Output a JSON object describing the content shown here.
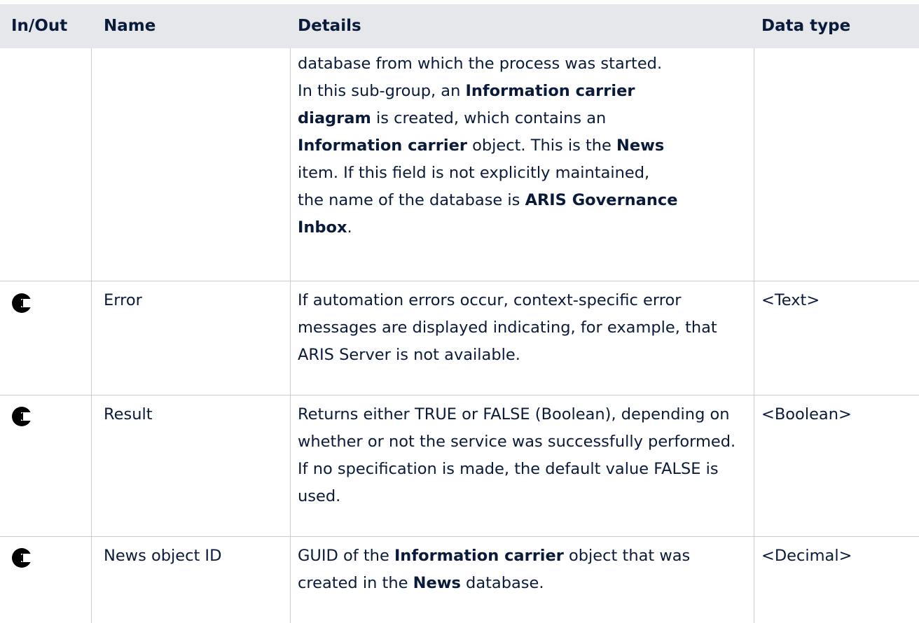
{
  "headers": {
    "inout": "In/Out",
    "name": "Name",
    "details": "Details",
    "datatype": "Data type"
  },
  "continued": {
    "line1": "database from which the process was started.",
    "line2a": "In this sub-group, an ",
    "line2b": "Information carrier",
    "line3a": "diagram",
    "line3b": " is created, which contains an",
    "line4a": "Information carrier",
    "line4b": " object. This is the ",
    "line4c": "News",
    "line5": "item. If this field is not explicitly maintained,",
    "line6a": "the name of the database is ",
    "line6b": "ARIS Governance",
    "line7a": "Inbox",
    "line7b": "."
  },
  "rows": [
    {
      "name": "Error",
      "details": "If automation errors occur, context-specific error messages are displayed indicating, for example, that ARIS Server is not available.",
      "datatype": "<Text>"
    },
    {
      "name": "Result",
      "details": "Returns either TRUE or FALSE (Boolean), depending on whether or not the service was successfully performed. If no specification is made, the default value FALSE is used.",
      "datatype": "<Boolean>"
    },
    {
      "name": "News object ID",
      "details_a": "GUID of the ",
      "details_b": "Information carrier",
      "details_c": " object that was created in the ",
      "details_d": "News",
      "details_e": " database.",
      "datatype": "<Decimal>"
    }
  ],
  "icons": {
    "output": "output-arrow-icon"
  }
}
